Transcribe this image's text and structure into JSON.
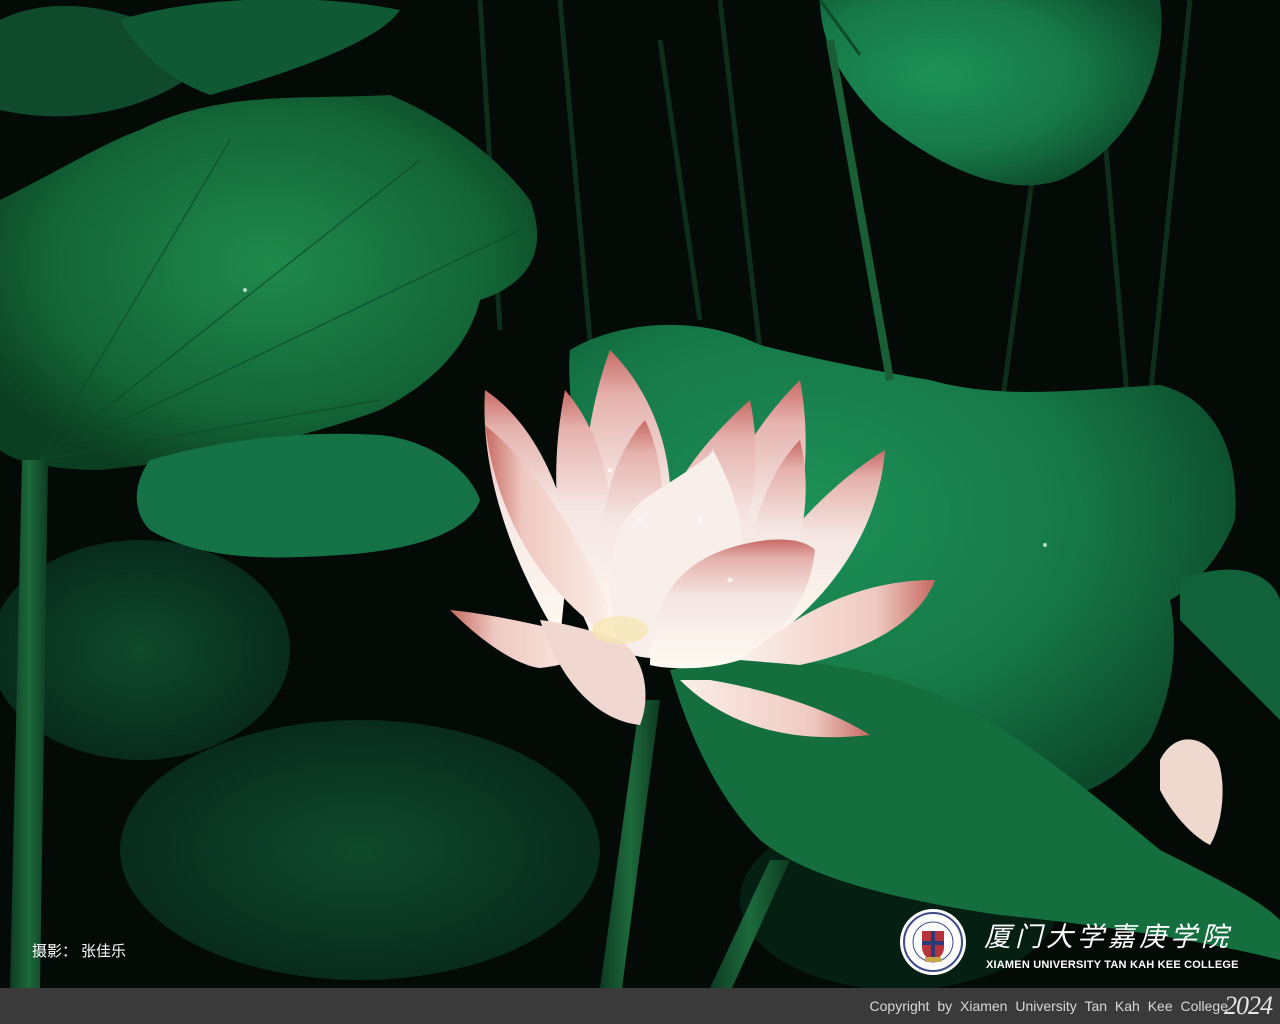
{
  "photo": {
    "subject": "lotus-flower",
    "colors": {
      "background": "#050b07",
      "leaf": "#1a7a45",
      "leaf_dark": "#0d3d24",
      "petal": "#f6ecea",
      "petal_tip": "#c0605f"
    }
  },
  "credit": {
    "label": "摄影：",
    "name": "张佳乐"
  },
  "logo": {
    "name_cn": "厦门大学嘉庚学院",
    "name_en": "XIAMEN UNIVERSITY TAN KAH KEE COLLEGE",
    "seal_icon": "college-seal-icon"
  },
  "footer": {
    "copyright": "Copyright by Xiamen University Tan Kah Kee College",
    "year": "2024"
  }
}
